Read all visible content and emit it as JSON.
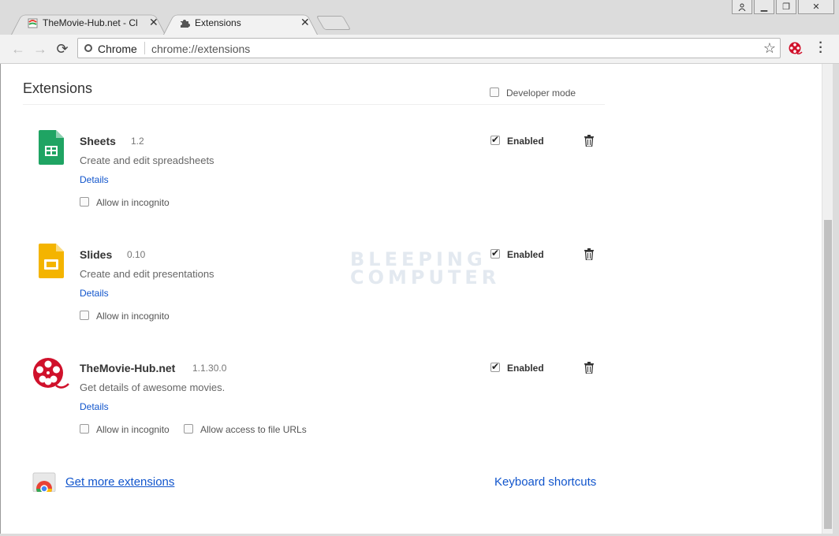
{
  "tabs": [
    {
      "title": "TheMovie-Hub.net - Chrome"
    },
    {
      "title": "Extensions"
    }
  ],
  "omnibox": {
    "site_label": "Chrome",
    "url": "chrome://extensions"
  },
  "page": {
    "title": "Extensions",
    "developer_mode_label": "Developer mode",
    "developer_mode_checked": false
  },
  "extensions": [
    {
      "name": "Sheets",
      "version": "1.2",
      "description": "Create and edit spreadsheets",
      "details": "Details",
      "incognito_label": "Allow in incognito",
      "enabled_label": "Enabled",
      "enabled": true,
      "icon": "google-sheets-icon"
    },
    {
      "name": "Slides",
      "version": "0.10",
      "description": "Create and edit presentations",
      "details": "Details",
      "incognito_label": "Allow in incognito",
      "enabled_label": "Enabled",
      "enabled": true,
      "icon": "google-slides-icon"
    },
    {
      "name": "TheMovie-Hub.net",
      "version": "1.1.30.0",
      "description": "Get details of awesome movies.",
      "details": "Details",
      "incognito_label": "Allow in incognito",
      "file_urls_label": "Allow access to file URLs",
      "enabled_label": "Enabled",
      "enabled": true,
      "icon": "film-reel-icon"
    }
  ],
  "footer": {
    "get_more": "Get more extensions",
    "shortcuts": "Keyboard shortcuts"
  },
  "watermark": {
    "line1": "BLEEPING",
    "line2": "COMPUTER"
  },
  "colors": {
    "link": "#1155cc",
    "sheets_green": "#1fa463",
    "slides_yellow": "#f4b400",
    "moviehub_red": "#d0112b"
  }
}
